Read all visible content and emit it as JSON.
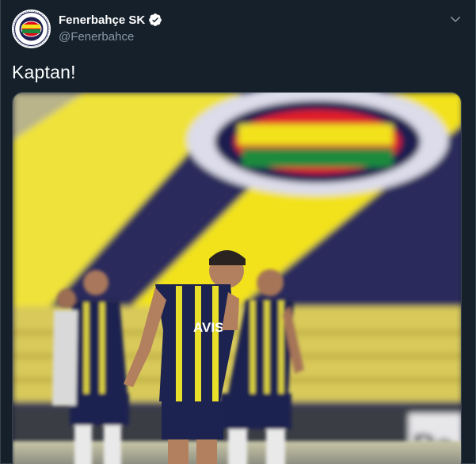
{
  "tweet": {
    "author": {
      "display_name": "Fenerbahçe SK",
      "handle": "@Fenerbahce",
      "verified": true,
      "avatar_icon": "fenerbahce-crest-icon"
    },
    "text": "Kaptan!",
    "menu_icon": "chevron-down-icon",
    "media": {
      "type": "photo",
      "shirt_sponsor": "AVIS"
    }
  },
  "colors": {
    "background": "#15202b",
    "secondary_text": "#8899a6",
    "verified_badge": "#ffffff",
    "club_yellow": "#f2e21b",
    "club_navy": "#1c1f4f"
  }
}
